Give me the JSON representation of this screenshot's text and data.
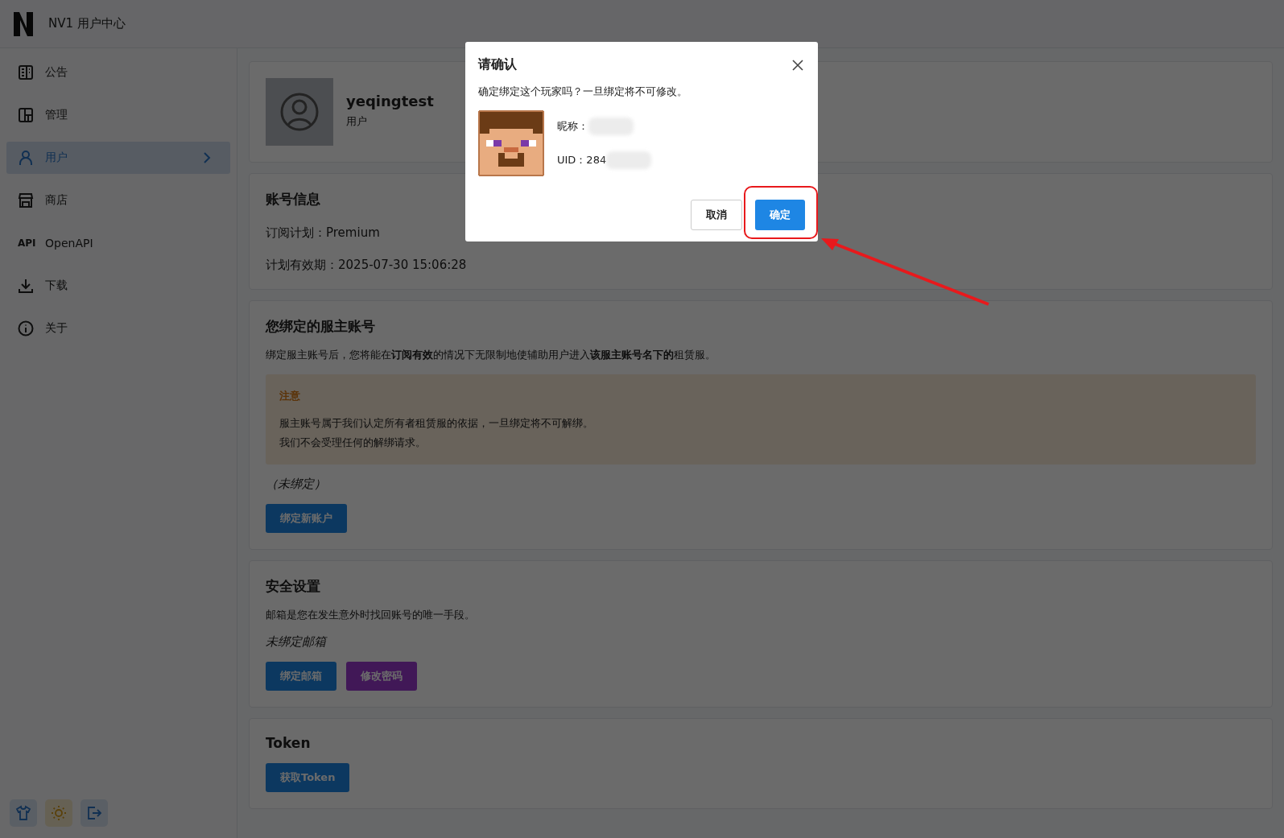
{
  "header": {
    "title": "NV1 用户中心"
  },
  "sidebar": {
    "items": [
      {
        "label": "公告",
        "selected": false
      },
      {
        "label": "管理",
        "selected": false
      },
      {
        "label": "用户",
        "selected": true
      },
      {
        "label": "商店",
        "selected": false
      },
      {
        "label": "OpenAPI",
        "icon_text": "API",
        "selected": false
      },
      {
        "label": "下载",
        "selected": false
      },
      {
        "label": "关于",
        "selected": false
      }
    ]
  },
  "profile": {
    "username": "yeqingtest",
    "role": "用户"
  },
  "account": {
    "title": "账号信息",
    "lines": [
      "订阅计划：Premium",
      "计划有效期：2025-07-30 15:06:28"
    ]
  },
  "binding": {
    "title": "您绑定的服主账号",
    "description": "绑定服主账号后，您将能在**订阅有效**的情况下无限制地使辅助用户进入**该服主账号名下的**租赁服。",
    "notice": {
      "title": "注意",
      "lines": [
        "服主账号属于我们认定所有者租赁服的依据，一旦绑定将不可解绑。",
        "我们不会受理任何的解绑请求。"
      ]
    },
    "status": "（未绑定）",
    "button": "绑定新账户"
  },
  "security": {
    "title": "安全设置",
    "description": "邮箱是您在发生意外时找回账号的唯一手段。",
    "status": "未绑定邮箱",
    "buttons": [
      {
        "label": "绑定邮箱",
        "kind": "primary"
      },
      {
        "label": "修改密码",
        "kind": "purple"
      }
    ]
  },
  "token": {
    "title": "Token",
    "button": "获取Token"
  },
  "dialog": {
    "title": "请确认",
    "message": "确定绑定这个玩家吗？一旦绑定将不可修改。",
    "fields": [
      "昵称：",
      "UID：284"
    ],
    "buttons": [
      {
        "label": "取消",
        "kind": "default"
      },
      {
        "label": "确定",
        "kind": "primary"
      }
    ]
  }
}
